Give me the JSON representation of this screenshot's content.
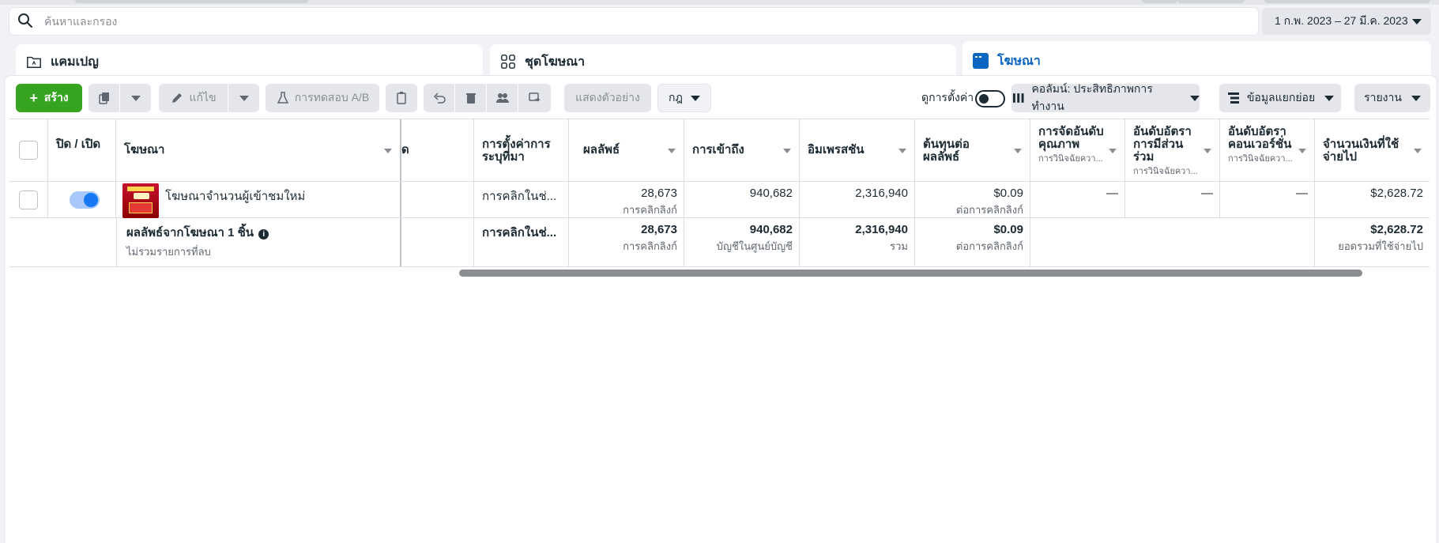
{
  "search": {
    "placeholder": "ค้นหาและกรอง"
  },
  "date_range": {
    "label": "1 ก.พ. 2023 – 27 มี.ค. 2023"
  },
  "tabs": [
    {
      "label": "แคมเปญ",
      "icon": "folder-icon"
    },
    {
      "label": "ชุดโฆษณา",
      "icon": "grid-icon"
    },
    {
      "label": "โฆษณา",
      "icon": "ad-icon"
    }
  ],
  "toolbar": {
    "create_label": "สร้าง",
    "edit_label": "แก้ไข",
    "ab_test_label": "การทดสอบ A/B",
    "preview_label": "แสดงตัวอย่าง",
    "rules_label": "กฎ",
    "view_settings_label": "ดูการตั้งค่า",
    "columns_label": "คอลัมน์: ประสิทธิภาพการทำงาน",
    "breakdown_label": "ข้อมูลแยกย่อย",
    "reports_label": "รายงาน"
  },
  "table": {
    "headers": {
      "toggle": "ปิด / เปิด",
      "ad": "โฆษณา",
      "hidden_col": "ด",
      "attribution": "การตั้งค่าการระบุที่มา",
      "results": "ผลลัพธ์",
      "reach": "การเข้าถึง",
      "impressions": "อิมเพรสชัน",
      "cost_per_result": "ต้นทุนต่อผลลัพธ์",
      "quality_ranking": "การจัดอันดับคุณภาพ",
      "quality_ranking_sub": "การวินิจฉัยควา...",
      "engagement_ranking": "อันดับอัตราการมีส่วนร่วม",
      "engagement_ranking_sub": "การวินิจฉัยควา...",
      "conversion_ranking": "อันดับอัตราคอนเวอร์ชั่น",
      "conversion_ranking_sub": "การวินิจฉัยควา...",
      "amount_spent": "จำนวนเงินที่ใช้จ่ายไป"
    },
    "row": {
      "ad_name": "โฆษณาจำนวนผู้เข้าชมใหม่",
      "attribution": "การคลิกในช่...",
      "results": "28,673",
      "results_sub": "การคลิกลิงก์",
      "reach": "940,682",
      "impressions": "2,316,940",
      "cost_per_result": "$0.09",
      "cost_per_result_sub": "ต่อการคลิกลิงก์",
      "quality_ranking": "—",
      "engagement_ranking": "—",
      "conversion_ranking": "—",
      "amount_spent": "$2,628.72"
    },
    "summary": {
      "title": "ผลลัพธ์จากโฆษณา 1 ชิ้น",
      "subtitle": "ไม่รวมรายการที่ลบ",
      "attribution": "การคลิกในช่...",
      "results": "28,673",
      "results_sub": "การคลิกลิงก์",
      "reach": "940,682",
      "reach_sub": "บัญชีในศูนย์บัญชี",
      "impressions": "2,316,940",
      "impressions_sub": "รวม",
      "cost_per_result": "$0.09",
      "cost_per_result_sub": "ต่อการคลิกลิงก์",
      "amount_spent": "$2,628.72",
      "amount_spent_sub": "ยอดรวมที่ใช้จ่ายไป"
    }
  },
  "colors": {
    "accent_green": "#36a420",
    "active_tab_blue": "#0a66c2",
    "toggle_blue": "#1877f2"
  }
}
